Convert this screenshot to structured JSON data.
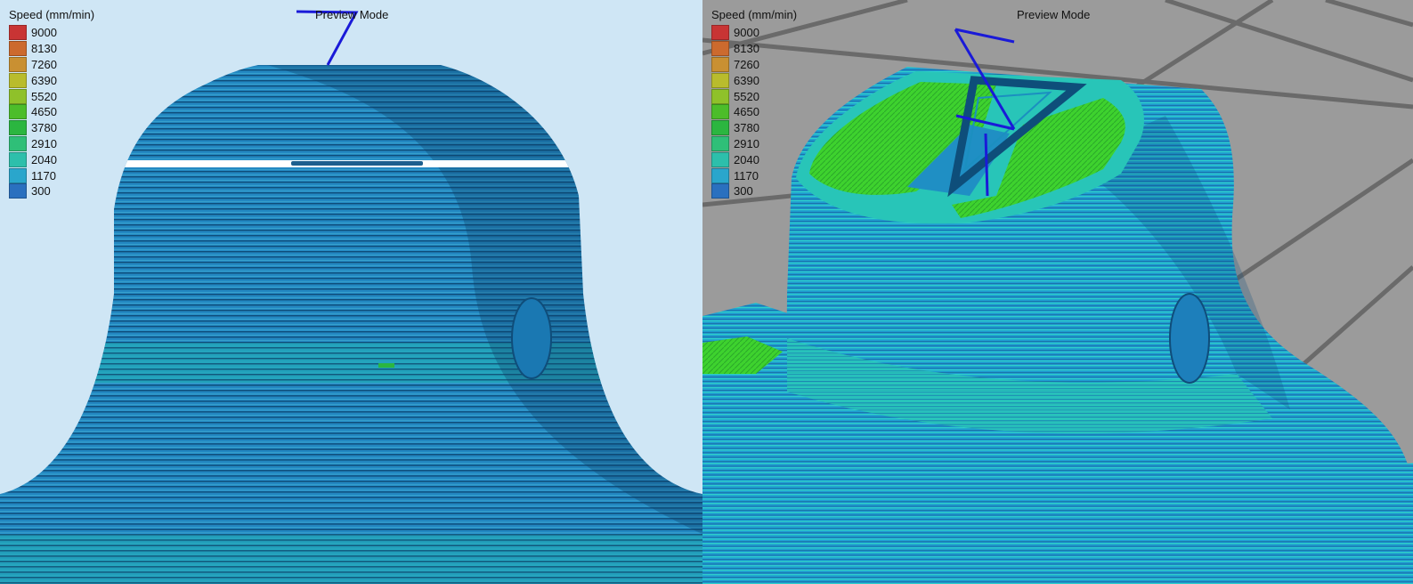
{
  "panels": [
    {
      "id": "left",
      "mode_label": "Preview Mode",
      "legend_title": "Speed (mm/min)",
      "background": "#cfe6f5"
    },
    {
      "id": "right",
      "mode_label": "Preview Mode",
      "legend_title": "Speed (mm/min)",
      "background": "#9a9a9a"
    }
  ],
  "legend": {
    "items": [
      {
        "value": "9000",
        "color": "#c83434"
      },
      {
        "value": "8130",
        "color": "#cc6a2e"
      },
      {
        "value": "7260",
        "color": "#c99032"
      },
      {
        "value": "6390",
        "color": "#b9bc2c"
      },
      {
        "value": "5520",
        "color": "#8fc12a"
      },
      {
        "value": "4650",
        "color": "#4cbd2a"
      },
      {
        "value": "3780",
        "color": "#2bb640"
      },
      {
        "value": "2910",
        "color": "#2fbf78"
      },
      {
        "value": "2040",
        "color": "#2dbfab"
      },
      {
        "value": "1170",
        "color": "#2aa6cc"
      },
      {
        "value": "300",
        "color": "#2a70bf"
      }
    ]
  },
  "colors": {
    "layer_blue": "#2387c0",
    "layer_teal": "#22b7b0",
    "infill_green": "#3ed22e",
    "travel_line": "#1a1ad8",
    "shadow": "#0b3d66"
  }
}
